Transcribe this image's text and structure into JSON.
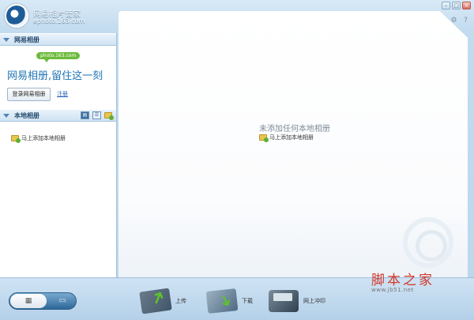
{
  "app": {
    "title": "网易相片管家",
    "url": "ephoto.163.com"
  },
  "window_controls": {
    "minimize": "–",
    "maximize": "□",
    "close": "×"
  },
  "tool_icons": {
    "lock": "🔒",
    "settings": "⚙",
    "help": "?"
  },
  "netease_section": {
    "header": "网易相册",
    "badge": "photo.163.com",
    "slogan": "网易相册,留住这一刻",
    "login_button": "登录网易相册",
    "register_link": "注册"
  },
  "local_section": {
    "header": "本地相册",
    "add_link": "马上添加本地相册"
  },
  "main": {
    "empty_title": "未添加任何本地相册",
    "add_link": "马上添加本地相册"
  },
  "bottom_bar": {
    "upload": "上传",
    "download": "下载",
    "print": "网上冲印"
  },
  "site_watermark": {
    "name": "脚本之家",
    "url": "www.jb51.net"
  },
  "colors": {
    "accent": "#1f74b5",
    "badge": "#6dbb3c",
    "watermark": "#d13a2a"
  }
}
